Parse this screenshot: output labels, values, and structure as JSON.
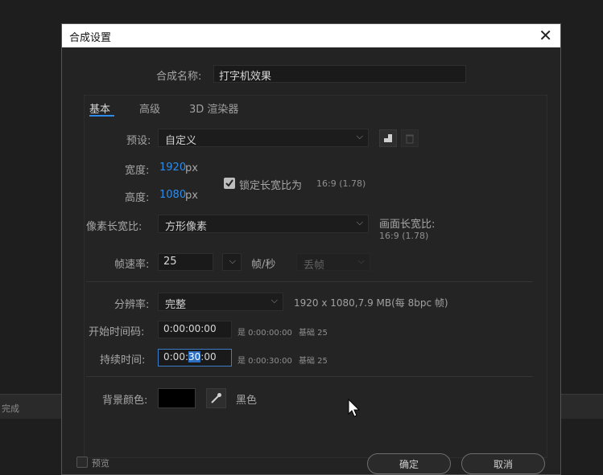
{
  "background": {
    "label": "完成"
  },
  "dialog": {
    "title": "合成设置",
    "comp_name_label": "合成名称:",
    "comp_name_value": "打字机效果",
    "tabs": [
      {
        "label": "基本",
        "active": true
      },
      {
        "label": "高级",
        "active": false
      },
      {
        "label": "3D 渲染器",
        "active": false
      }
    ],
    "preset_label": "预设:",
    "preset_value": "自定义",
    "width_label": "宽度:",
    "width_value": "1920",
    "width_unit": "px",
    "height_label": "高度:",
    "height_value": "1080",
    "height_unit": "px",
    "lock_aspect_label": "锁定长宽比为",
    "lock_aspect_ratio": "16:9 (1.78)",
    "lock_aspect_checked": true,
    "pixel_aspect_label": "像素长宽比:",
    "pixel_aspect_value": "方形像素",
    "frame_aspect_label": "画面长宽比:",
    "frame_aspect_value": "16:9 (1.78)",
    "frame_rate_label": "帧速率:",
    "frame_rate_value": "25",
    "frame_rate_unit": "帧/秒",
    "drop_frame_value": "丢帧",
    "resolution_label": "分辨率:",
    "resolution_value": "完整",
    "resolution_info": "1920 x 1080,7.9 MB(每 8bpc 帧)",
    "start_timecode_label": "开始时间码:",
    "start_timecode_value": "0:00:00:00",
    "start_timecode_info_prefix": "是 0:00:00:00",
    "start_timecode_info_base": "基础 25",
    "duration_label": "持续时间:",
    "duration_before": "0:00:",
    "duration_selected": "30",
    "duration_after": ":00",
    "duration_info_prefix": "是 0:00:30:00",
    "duration_info_base": "基础 25",
    "bg_color_label": "背景颜色:",
    "bg_color_hex": "#000000",
    "bg_color_name": "黑色",
    "preview_label": "预览",
    "ok_label": "确定",
    "cancel_label": "取消"
  }
}
